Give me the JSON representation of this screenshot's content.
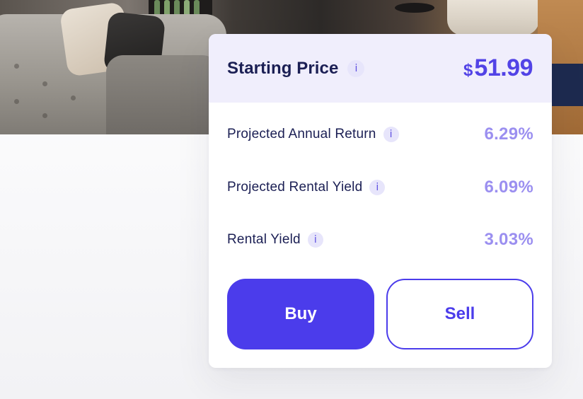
{
  "card": {
    "title": "Starting Price",
    "info_glyph": "i",
    "price": {
      "currency": "$",
      "value": "51.99"
    }
  },
  "metrics": [
    {
      "label": "Projected Annual Return",
      "value": "6.29%"
    },
    {
      "label": "Projected Rental Yield",
      "value": "6.09%"
    },
    {
      "label": "Rental Yield",
      "value": "3.03%"
    }
  ],
  "actions": {
    "buy_label": "Buy",
    "sell_label": "Sell"
  },
  "colors": {
    "accent": "#4b3ceb",
    "header_bg": "#f0eefc",
    "title_text": "#1b1f54",
    "metric_value": "#9b8ff0"
  },
  "icons": {
    "info": "info-icon"
  }
}
